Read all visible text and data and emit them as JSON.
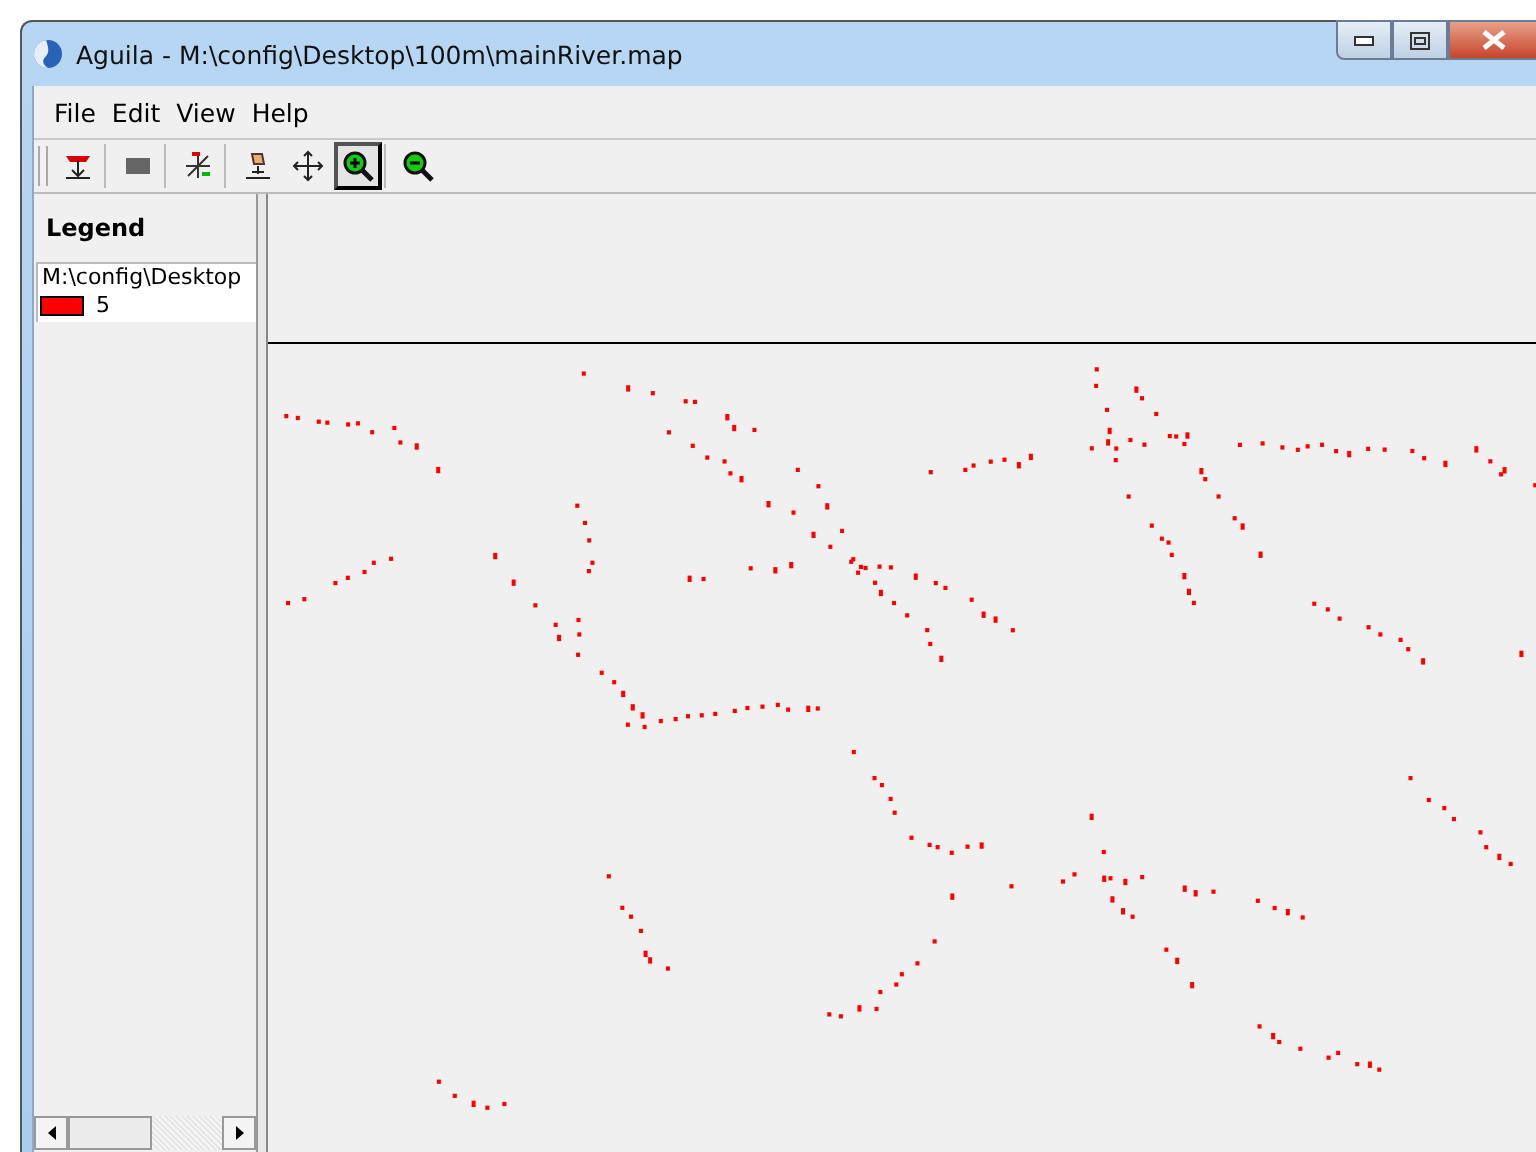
{
  "window": {
    "title": "Aguila - M:\\config\\Desktop\\100m\\mainRiver.map"
  },
  "menu": [
    {
      "label": "File"
    },
    {
      "label": "Edit"
    },
    {
      "label": "View"
    },
    {
      "label": "Help"
    }
  ],
  "toolbar": [
    {
      "kind": "layers",
      "selected": false
    },
    {
      "kind": "block",
      "selected": false
    },
    {
      "kind": "cursor",
      "selected": false
    },
    {
      "kind": "pan-hand",
      "selected": false
    },
    {
      "kind": "move",
      "selected": false
    },
    {
      "kind": "zoom-in",
      "selected": true
    },
    {
      "kind": "zoom-out",
      "selected": false
    }
  ],
  "legend": {
    "title": "Legend",
    "items": [
      {
        "path": "M:\\config\\Desktop",
        "value": "5",
        "color": "#ff0000"
      }
    ]
  }
}
